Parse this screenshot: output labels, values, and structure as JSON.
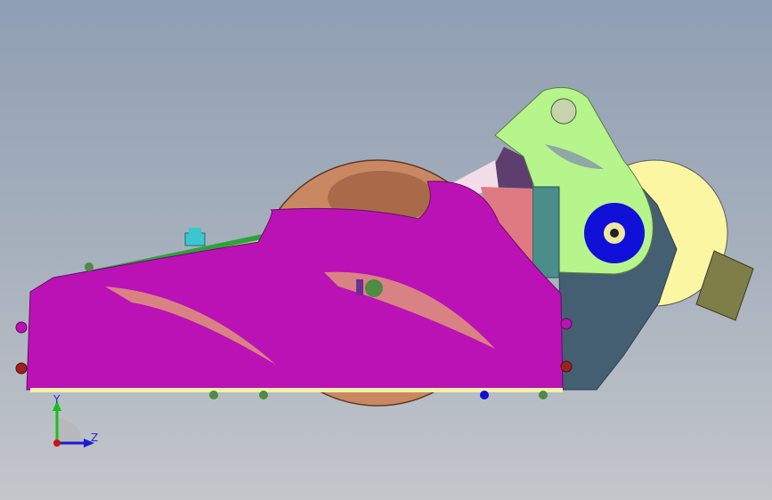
{
  "viewport": {
    "background_top": "#8f9fb3",
    "background_bottom": "#c3c6cb"
  },
  "model": {
    "description_icon": "cad-assembly",
    "colors": {
      "body_shell": "#bb12b6",
      "shell_cutout": "#d98284",
      "wheel": "#c98862",
      "wheel_dark": "#a86a48",
      "bracket": "#b6f48c",
      "disc": "#faf6a2",
      "dark_plate": "#455f72",
      "teal_block": "#4a8d8a",
      "olive_block": "#7f7d48",
      "hub_blue": "#1010d8",
      "purple_tab": "#5e3e6f",
      "green_strip": "#2ea23a",
      "cyan_part": "#3cc7cf"
    }
  },
  "triad": {
    "y_label": "Y",
    "z_label": "Z",
    "y_color": "#16c216",
    "z_color": "#1a1ad6",
    "x_color": "#d01010"
  }
}
